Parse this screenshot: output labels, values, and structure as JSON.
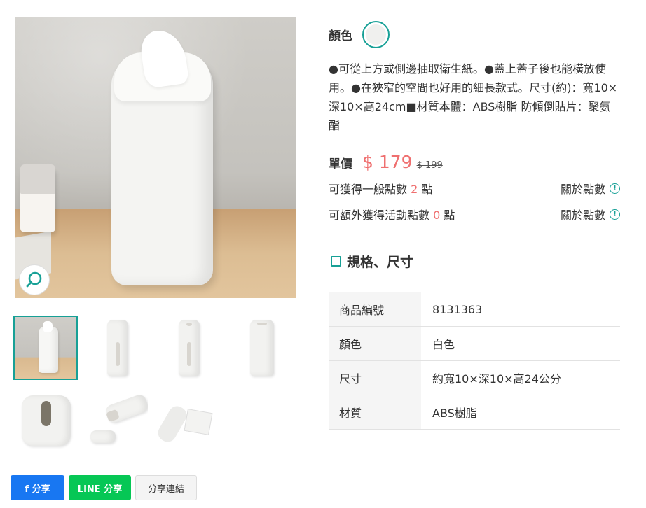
{
  "product": {
    "color_label": "顏色",
    "description": "●可從上方或側邊抽取衛生紙。●蓋上蓋子後也能橫放使用。●在狹窄的空間也好用的細長款式。尺寸(約)：寬10×深10×高24cm■材質本體：ABS樹脂 防傾倒貼片：聚氨酯",
    "price_label": "單價",
    "price": "$ 179",
    "original_price": "$ 199",
    "accent_color": "#17a096",
    "price_color": "#ef6f6f"
  },
  "points": {
    "general_prefix": "可獲得一般點數",
    "general_value": "2",
    "general_suffix": "點",
    "event_prefix": "可額外獲得活動點數",
    "event_value": "0",
    "event_suffix": "點",
    "about_label": "關於點數"
  },
  "spec": {
    "title": "規格、尺寸",
    "rows": [
      {
        "key": "商品編號",
        "value": "8131363"
      },
      {
        "key": "顏色",
        "value": "白色"
      },
      {
        "key": "尺寸",
        "value": "約寬10×深10×高24公分"
      },
      {
        "key": "材質",
        "value": "ABS樹脂"
      }
    ]
  },
  "share": {
    "facebook_label": "f 分享",
    "line_label": "LINE 分享",
    "link_label": "分享連結"
  },
  "icons": [
    "zoom-icon",
    "info-icon",
    "spec-icon"
  ]
}
